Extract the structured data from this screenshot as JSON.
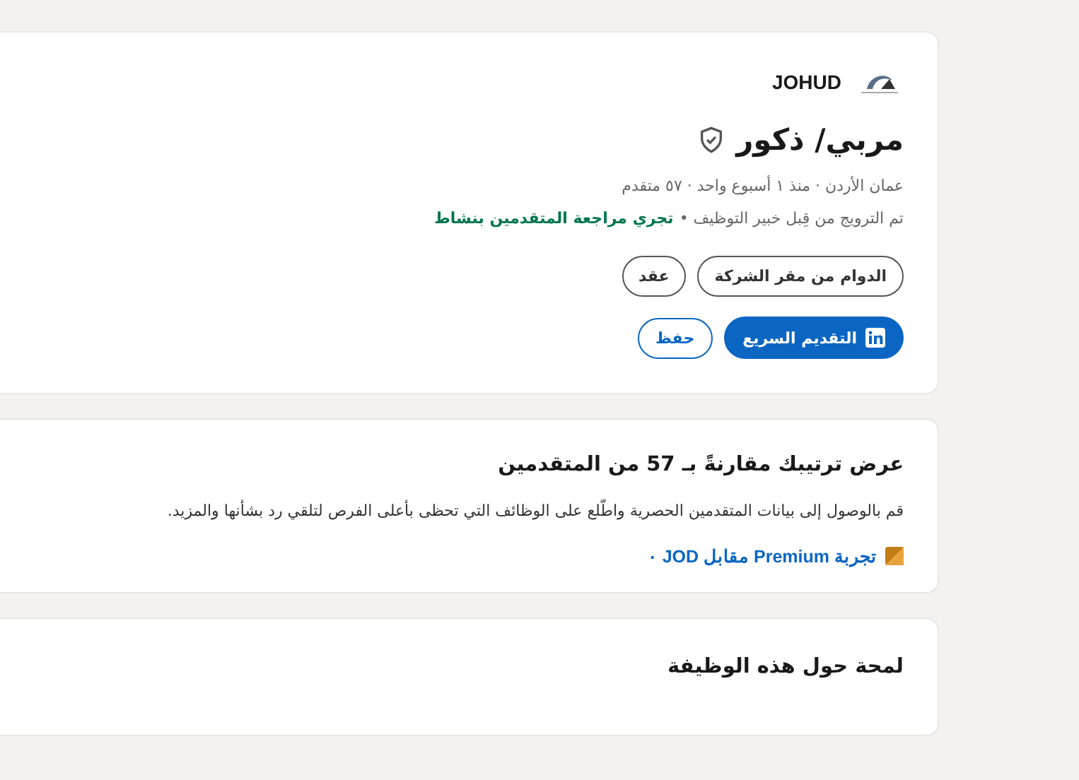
{
  "job_card": {
    "company": "JOHUD",
    "title": "مربي/ ذكور",
    "meta": "عمان الأردن · منذ ١ أسبوع واحد · ٥٧ متقدم",
    "promoted": "تم الترويج من قِبل خبير التوظيف •",
    "activity": "تجري مراجعة المتقدمين بنشاط",
    "tags": [
      "الدوام من مقر الشركة",
      "عقد"
    ],
    "buttons": [
      {
        "kind": "primary",
        "label": "التقديم السريع"
      },
      {
        "kind": "secondary",
        "label": "حفظ"
      }
    ]
  },
  "premium_card": {
    "heading": "عرض ترتيبك مقارنةً بـ 57 من المتقدمين",
    "body": "قم بالوصول إلى بيانات المتقدمين الحصرية واطّلع على الوظائف التي تحظى بأعلى الفرص لتلقي رد بشأنها والمزيد.",
    "offer": "تجربة Premium مقابل JOD ٠"
  },
  "about_card": {
    "heading": "لمحة حول هذه الوظيفة"
  }
}
